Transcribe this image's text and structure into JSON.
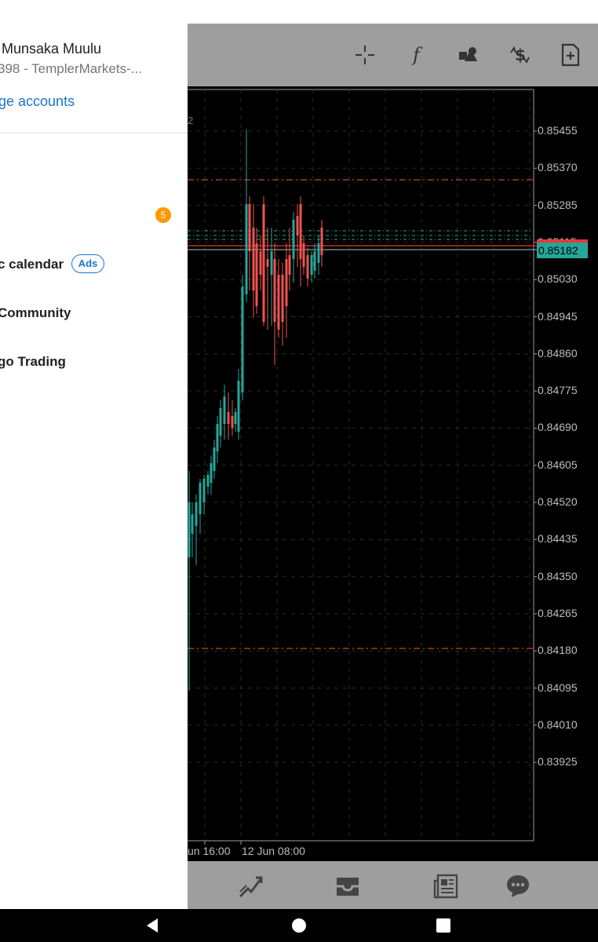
{
  "drawer": {
    "account_name": "Munsaka Muulu",
    "account_sub": "398 - TemplerMarkets-...",
    "manage_link": "ge accounts",
    "badge_count": "5",
    "menu": [
      {
        "label": "c calendar",
        "tag": "Ads"
      },
      {
        "label": "Community"
      },
      {
        "label": "go Trading"
      }
    ]
  },
  "toolbar": {
    "icons": [
      "crosshair-icon",
      "function-icon",
      "objects-icon",
      "trade-icon",
      "new-order-icon"
    ]
  },
  "chart": {
    "corner_text": "2",
    "price_ticks": [
      "0.85455",
      "0.85370",
      "0.85285",
      "0.85115",
      "0.85030",
      "0.84945",
      "0.84860",
      "0.84775",
      "0.84690",
      "0.84605",
      "0.84520",
      "0.84435",
      "0.84350",
      "0.84265",
      "0.84180",
      "0.84095",
      "0.84010",
      "0.83925"
    ],
    "bid_price": "0.85182",
    "time_labels": [
      "un 16:00",
      "12 Jun 08:00"
    ],
    "colors": {
      "bull": "#26a69a",
      "bear": "#ef5350",
      "level": "#ff5722",
      "grid": "#2a2a2a"
    }
  },
  "bottomnav": {
    "icons": [
      "trade-history-icon",
      "inbox-icon",
      "news-icon",
      "chat-icon"
    ]
  }
}
